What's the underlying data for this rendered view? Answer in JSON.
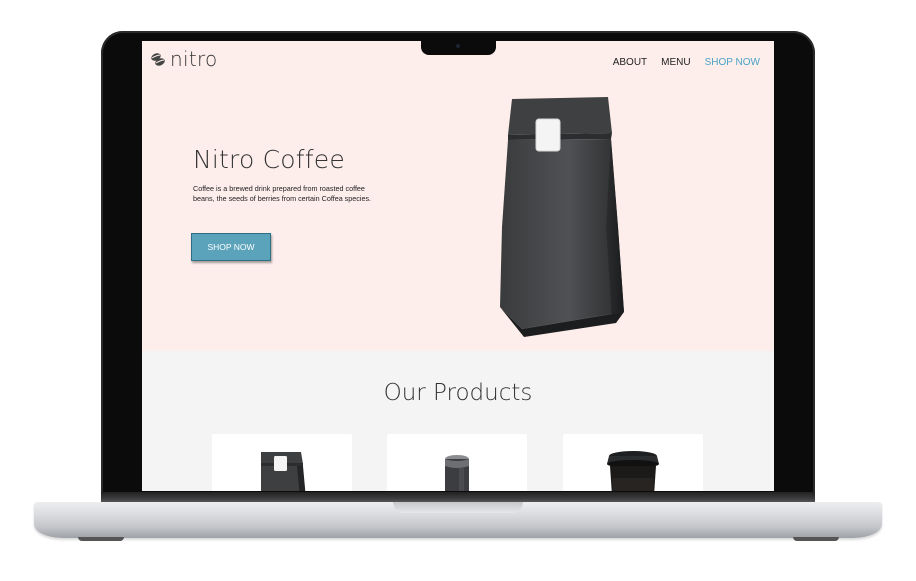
{
  "site": {
    "brand": "nitro",
    "nav": [
      {
        "label": "ABOUT",
        "active": false
      },
      {
        "label": "MENU",
        "active": false
      },
      {
        "label": "SHOP NOW",
        "active": true
      }
    ]
  },
  "hero": {
    "title": "Nitro Coffee",
    "description": "Coffee is a brewed drink prepared from roasted coffee beans, the seeds of berries from certain Coffea species.",
    "cta_label": "SHOP NOW",
    "image_icon": "coffee-bag"
  },
  "products": {
    "title": "Our Products",
    "items": [
      {
        "icon": "coffee-bag"
      },
      {
        "icon": "coffee-can"
      },
      {
        "icon": "coffee-cup"
      }
    ]
  },
  "colors": {
    "hero_bg": "#fdeeec",
    "accent": "#4aa3c3",
    "button_bg": "#5aa3bb",
    "section_bg": "#f4f4f4"
  }
}
